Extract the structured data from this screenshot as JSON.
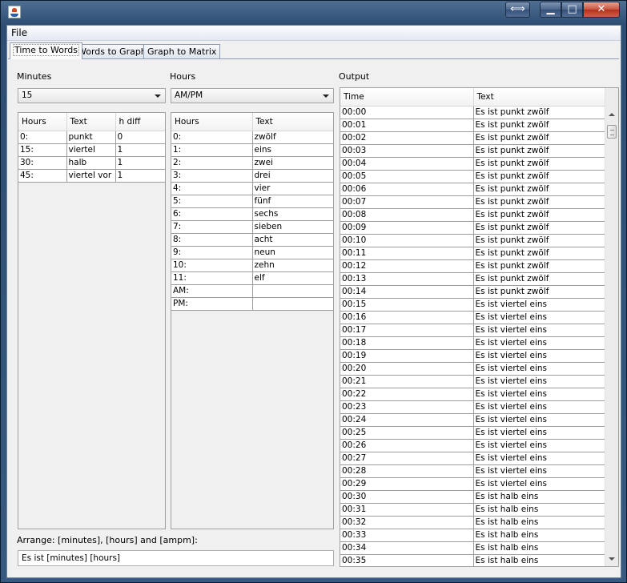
{
  "window": {
    "resize_glyph": "⟺",
    "min_glyph": "▁",
    "max_glyph": "□",
    "close_glyph": "✕"
  },
  "menu": {
    "file": "File"
  },
  "tabs": [
    {
      "label": "Time to Words",
      "active": true
    },
    {
      "label": "Words to Graph",
      "active": false
    },
    {
      "label": "Graph to Matrix",
      "active": false
    }
  ],
  "minutes": {
    "label": "Minutes",
    "selected": "15",
    "headers": [
      "Hours",
      "Text",
      "h diff"
    ],
    "rows": [
      [
        "0:",
        "punkt",
        "0"
      ],
      [
        "15:",
        "viertel",
        "1"
      ],
      [
        "30:",
        "halb",
        "1"
      ],
      [
        "45:",
        "viertel vor",
        "1"
      ]
    ]
  },
  "hours": {
    "label": "Hours",
    "selected": "AM/PM",
    "headers": [
      "Hours",
      "Text"
    ],
    "rows": [
      [
        "0:",
        "zwölf"
      ],
      [
        "1:",
        "eins"
      ],
      [
        "2:",
        "zwei"
      ],
      [
        "3:",
        "drei"
      ],
      [
        "4:",
        "vier"
      ],
      [
        "5:",
        "fünf"
      ],
      [
        "6:",
        "sechs"
      ],
      [
        "7:",
        "sieben"
      ],
      [
        "8:",
        "acht"
      ],
      [
        "9:",
        "neun"
      ],
      [
        "10:",
        "zehn"
      ],
      [
        "11:",
        "elf"
      ],
      [
        "AM:",
        ""
      ],
      [
        "PM:",
        ""
      ]
    ]
  },
  "output": {
    "label": "Output",
    "headers": [
      "Time",
      "Text"
    ],
    "rows": [
      [
        "00:00",
        "Es ist punkt zwölf"
      ],
      [
        "00:01",
        "Es ist punkt zwölf"
      ],
      [
        "00:02",
        "Es ist punkt zwölf"
      ],
      [
        "00:03",
        "Es ist punkt zwölf"
      ],
      [
        "00:04",
        "Es ist punkt zwölf"
      ],
      [
        "00:05",
        "Es ist punkt zwölf"
      ],
      [
        "00:06",
        "Es ist punkt zwölf"
      ],
      [
        "00:07",
        "Es ist punkt zwölf"
      ],
      [
        "00:08",
        "Es ist punkt zwölf"
      ],
      [
        "00:09",
        "Es ist punkt zwölf"
      ],
      [
        "00:10",
        "Es ist punkt zwölf"
      ],
      [
        "00:11",
        "Es ist punkt zwölf"
      ],
      [
        "00:12",
        "Es ist punkt zwölf"
      ],
      [
        "00:13",
        "Es ist punkt zwölf"
      ],
      [
        "00:14",
        "Es ist punkt zwölf"
      ],
      [
        "00:15",
        "Es ist viertel eins"
      ],
      [
        "00:16",
        "Es ist viertel eins"
      ],
      [
        "00:17",
        "Es ist viertel eins"
      ],
      [
        "00:18",
        "Es ist viertel eins"
      ],
      [
        "00:19",
        "Es ist viertel eins"
      ],
      [
        "00:20",
        "Es ist viertel eins"
      ],
      [
        "00:21",
        "Es ist viertel eins"
      ],
      [
        "00:22",
        "Es ist viertel eins"
      ],
      [
        "00:23",
        "Es ist viertel eins"
      ],
      [
        "00:24",
        "Es ist viertel eins"
      ],
      [
        "00:25",
        "Es ist viertel eins"
      ],
      [
        "00:26",
        "Es ist viertel eins"
      ],
      [
        "00:27",
        "Es ist viertel eins"
      ],
      [
        "00:28",
        "Es ist viertel eins"
      ],
      [
        "00:29",
        "Es ist viertel eins"
      ],
      [
        "00:30",
        "Es ist halb eins"
      ],
      [
        "00:31",
        "Es ist halb eins"
      ],
      [
        "00:32",
        "Es ist halb eins"
      ],
      [
        "00:33",
        "Es ist halb eins"
      ],
      [
        "00:34",
        "Es ist halb eins"
      ],
      [
        "00:35",
        "Es ist halb eins"
      ]
    ]
  },
  "arrange": {
    "label": "Arrange: [minutes], [hours] and [ampm]:",
    "value": "Es ist [minutes] [hours]"
  }
}
